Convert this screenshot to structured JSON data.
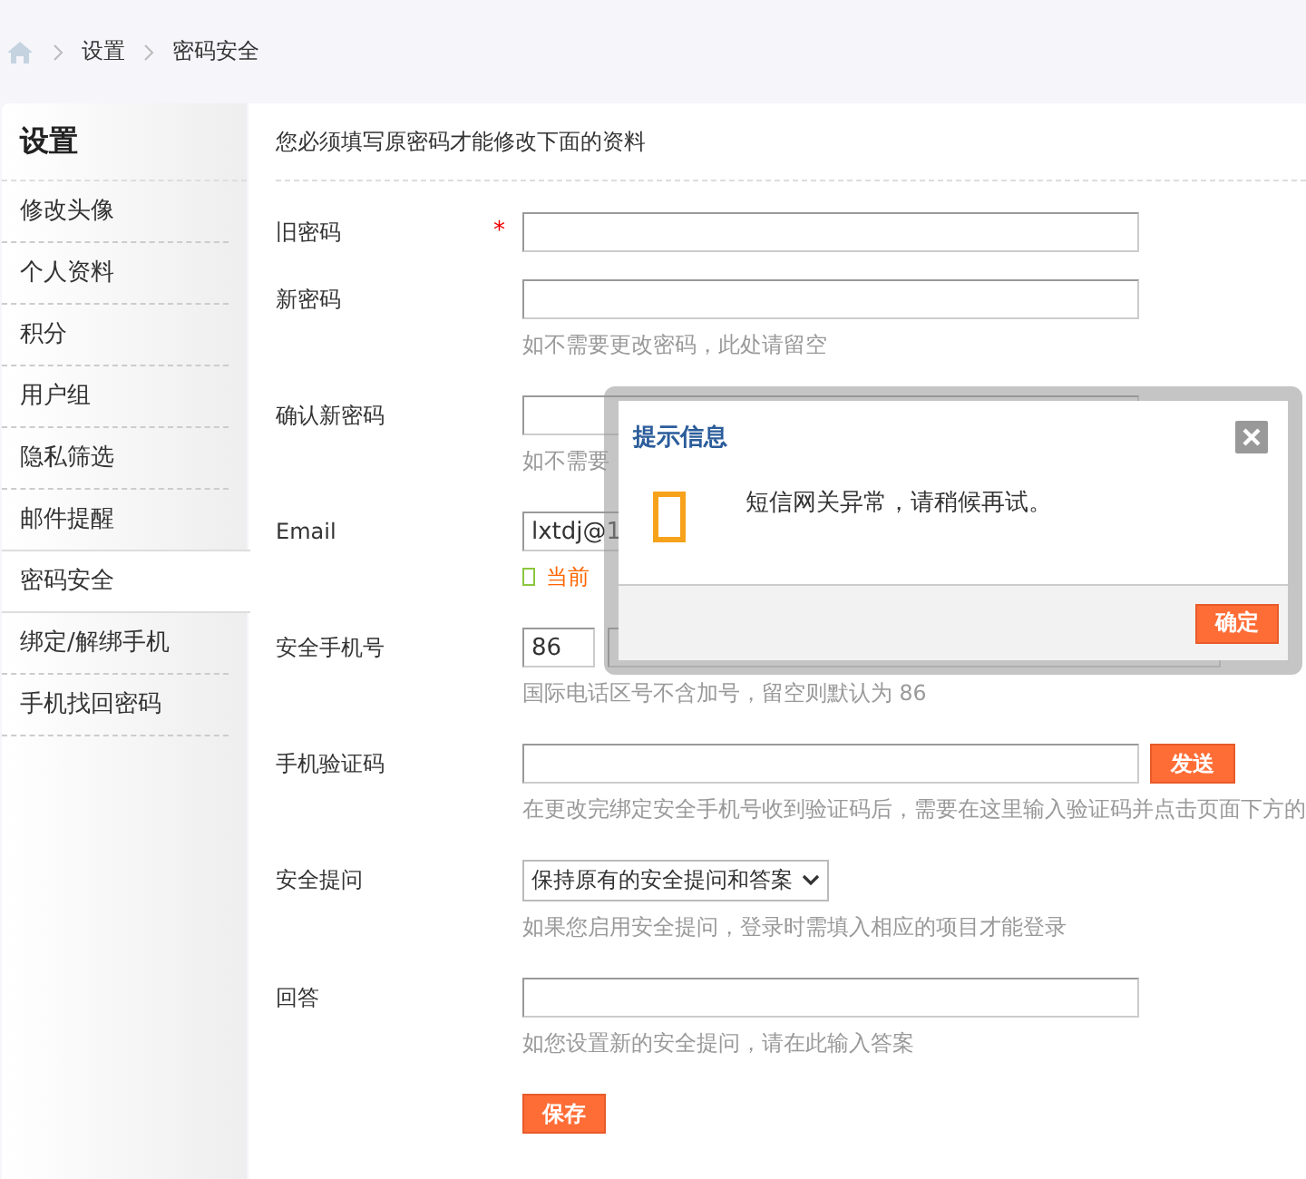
{
  "breadcrumb": [
    "设置",
    "密码安全"
  ],
  "sidebar": {
    "title": "设置",
    "items": [
      {
        "label": "修改头像",
        "selected": false
      },
      {
        "label": "个人资料",
        "selected": false
      },
      {
        "label": "积分",
        "selected": false
      },
      {
        "label": "用户组",
        "selected": false
      },
      {
        "label": "隐私筛选",
        "selected": false
      },
      {
        "label": "邮件提醒",
        "selected": false
      },
      {
        "label": "密码安全",
        "selected": true
      },
      {
        "label": "绑定/解绑手机",
        "selected": false
      },
      {
        "label": "手机找回密码",
        "selected": false
      }
    ]
  },
  "notice": "您必须填写原密码才能修改下面的资料",
  "form": {
    "fields": [
      {
        "kind": "password",
        "label": "旧密码",
        "required_mark": "*"
      },
      {
        "kind": "password",
        "label": "新密码",
        "hint": "如不需要更改密码，此处请留空"
      },
      {
        "kind": "password",
        "label": "确认新密码",
        "hint": "如不需要"
      },
      {
        "kind": "text",
        "label": "Email",
        "value": "lxtdj@1",
        "status": "当前"
      },
      {
        "kind": "phone",
        "label": "安全手机号",
        "country_code": "86",
        "hint": "国际电话区号不含加号，留空则默认为 86"
      },
      {
        "kind": "code",
        "label": "手机验证码",
        "button": "发送",
        "hint": "在更改完绑定安全手机号收到验证码后，需要在这里输入验证码并点击页面下方的"
      },
      {
        "kind": "select",
        "label": "安全提问",
        "value": "保持原有的安全提问和答案",
        "hint": "如果您启用安全提问，登录时需填入相应的项目才能登录"
      },
      {
        "kind": "text",
        "label": "回答",
        "hint": "如您设置新的安全提问，请在此输入答案"
      }
    ],
    "submit": "保存"
  },
  "dialog": {
    "title": "提示信息",
    "message": "短信网关异常，请稍候再试。",
    "button": "确定"
  }
}
